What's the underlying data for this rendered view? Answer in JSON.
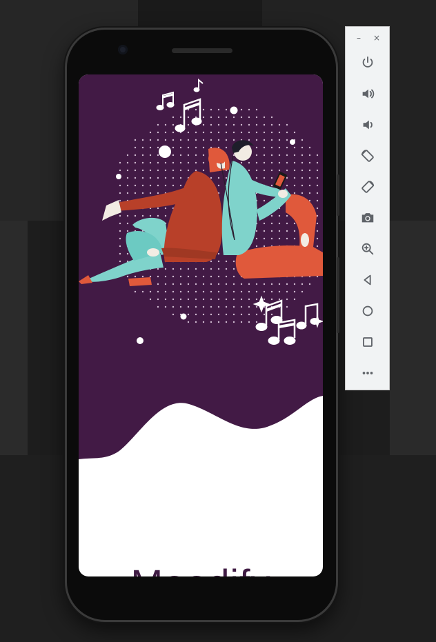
{
  "app": {
    "name": "Moodify"
  },
  "emulator_controls": {
    "window": [
      {
        "name": "minimize",
        "glyph": "–"
      },
      {
        "name": "close",
        "glyph": "×"
      }
    ],
    "tools": [
      {
        "name": "power",
        "icon": "power-icon"
      },
      {
        "name": "volume-up",
        "icon": "volume-up-icon"
      },
      {
        "name": "volume-down",
        "icon": "volume-down-icon"
      },
      {
        "name": "rotate-left",
        "icon": "rotate-left-icon"
      },
      {
        "name": "rotate-right",
        "icon": "rotate-right-icon"
      },
      {
        "name": "screenshot",
        "icon": "camera-icon"
      },
      {
        "name": "zoom",
        "icon": "zoom-in-icon"
      },
      {
        "name": "back",
        "icon": "back-icon"
      },
      {
        "name": "home",
        "icon": "home-icon"
      },
      {
        "name": "overview",
        "icon": "overview-icon"
      },
      {
        "name": "more",
        "icon": "more-icon"
      }
    ]
  },
  "colors": {
    "brand_purple": "#3f1b43",
    "illustration_bg": "#421a45",
    "teal": "#7fd3cb",
    "red_orange": "#e0593b",
    "dark_red": "#b84029",
    "toolbar_icon": "#5f6368"
  }
}
